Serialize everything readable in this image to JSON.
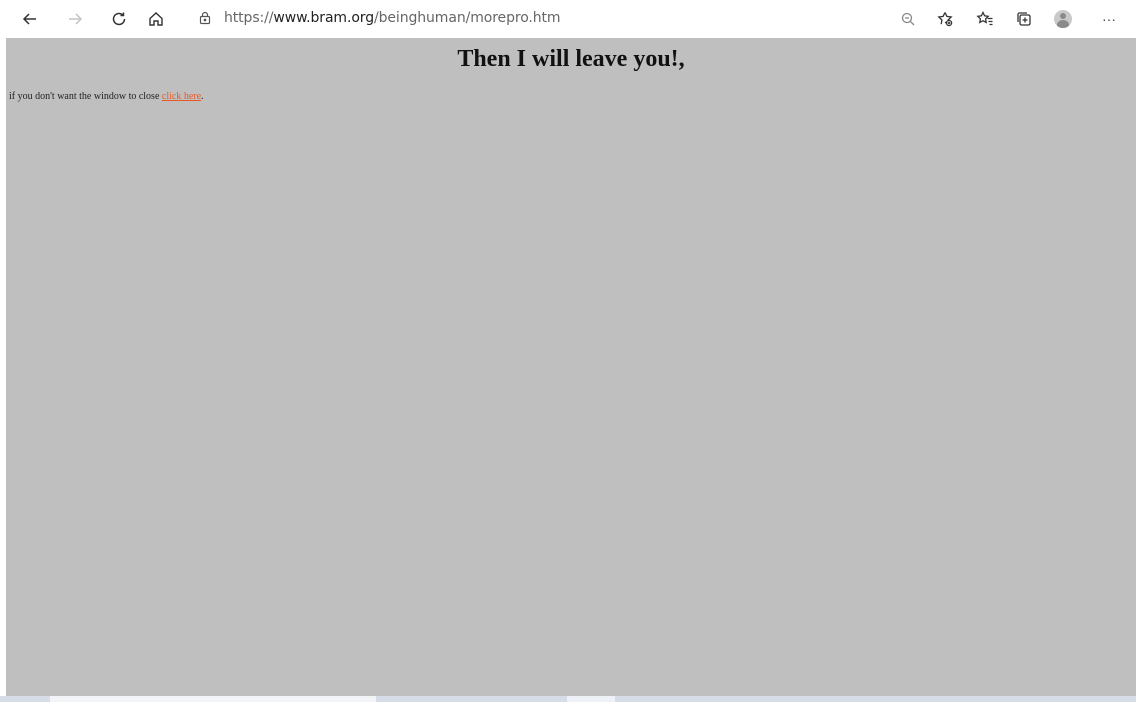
{
  "browser": {
    "url_prefix": "https://",
    "url_domain": "www.bram.org",
    "url_path": "/beinghuman/morepro.htm",
    "icons": {
      "back": "back-arrow-icon",
      "forward": "forward-arrow-icon",
      "refresh": "refresh-icon",
      "home": "home-icon",
      "lock": "lock-icon",
      "zoom": "zoom-icon",
      "add_favorite": "add-favorite-icon",
      "favorites": "favorites-icon",
      "collections": "collections-icon",
      "profile": "profile-icon",
      "more": "more-icon"
    },
    "more_label": "···"
  },
  "page": {
    "background": "#bfbfbf",
    "headline": "Then I will leave you!,",
    "text_before_link": "if you don't want the window to close ",
    "link_text": "click here",
    "text_after_link": ".",
    "link_color": "#e85a25"
  }
}
